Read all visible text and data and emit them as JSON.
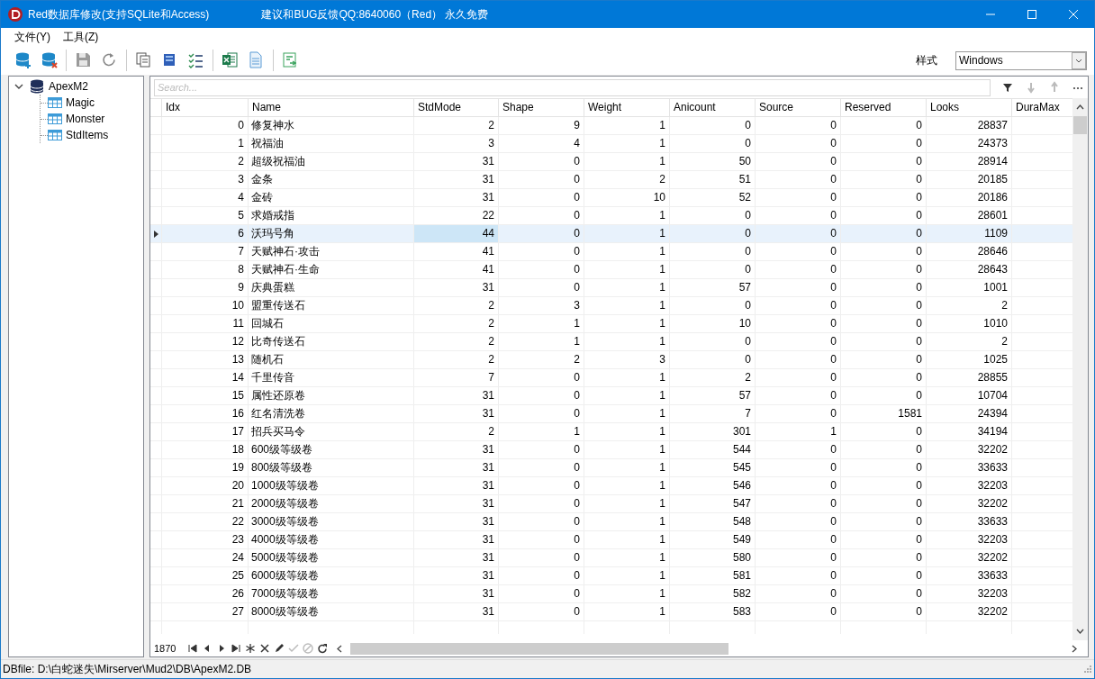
{
  "window": {
    "title": "Red数据库修改(支持SQLite和Access)",
    "subtitle": "建议和BUG反馈QQ:8640060（Red） 永久免费"
  },
  "menu": [
    "文件(Y)",
    "工具(Z)"
  ],
  "toolbar": {
    "style_label": "样式",
    "style_value": "Windows"
  },
  "tree": {
    "label": "ApexM2",
    "expanded": true,
    "children": [
      {
        "label": "Magic"
      },
      {
        "label": "Monster"
      },
      {
        "label": "StdItems"
      }
    ]
  },
  "grid": {
    "search_placeholder": "Search...",
    "columns": [
      "Idx",
      "Name",
      "StdMode",
      "Shape",
      "Weight",
      "Anicount",
      "Source",
      "Reserved",
      "Looks",
      "DuraMax"
    ],
    "rows": [
      {
        "selected": false,
        "cells": [
          "0",
          "修复神水",
          "2",
          "9",
          "1",
          "0",
          "0",
          "0",
          "28837"
        ]
      },
      {
        "selected": false,
        "cells": [
          "1",
          "祝福油",
          "3",
          "4",
          "1",
          "0",
          "0",
          "0",
          "24373"
        ]
      },
      {
        "selected": false,
        "cells": [
          "2",
          "超级祝福油",
          "31",
          "0",
          "1",
          "50",
          "0",
          "0",
          "28914"
        ]
      },
      {
        "selected": false,
        "cells": [
          "3",
          "金条",
          "31",
          "0",
          "2",
          "51",
          "0",
          "0",
          "20185"
        ]
      },
      {
        "selected": false,
        "cells": [
          "4",
          "金砖",
          "31",
          "0",
          "10",
          "52",
          "0",
          "0",
          "20186"
        ]
      },
      {
        "selected": false,
        "cells": [
          "5",
          "求婚戒指",
          "22",
          "0",
          "1",
          "0",
          "0",
          "0",
          "28601"
        ]
      },
      {
        "selected": true,
        "cells": [
          "6",
          "沃玛号角",
          "44",
          "0",
          "1",
          "0",
          "0",
          "0",
          "1109"
        ],
        "cell_focus": [
          false,
          false,
          true,
          false,
          false,
          false,
          false,
          false,
          false
        ]
      },
      {
        "selected": false,
        "cells": [
          "7",
          "天赋神石·攻击",
          "41",
          "0",
          "1",
          "0",
          "0",
          "0",
          "28646"
        ]
      },
      {
        "selected": false,
        "cells": [
          "8",
          "天赋神石·生命",
          "41",
          "0",
          "1",
          "0",
          "0",
          "0",
          "28643"
        ]
      },
      {
        "selected": false,
        "cells": [
          "9",
          "庆典蛋糕",
          "31",
          "0",
          "1",
          "57",
          "0",
          "0",
          "1001"
        ]
      },
      {
        "selected": false,
        "cells": [
          "10",
          "盟重传送石",
          "2",
          "3",
          "1",
          "0",
          "0",
          "0",
          "2"
        ]
      },
      {
        "selected": false,
        "cells": [
          "11",
          "回城石",
          "2",
          "1",
          "1",
          "10",
          "0",
          "0",
          "1010"
        ]
      },
      {
        "selected": false,
        "cells": [
          "12",
          "比奇传送石",
          "2",
          "1",
          "1",
          "0",
          "0",
          "0",
          "2"
        ]
      },
      {
        "selected": false,
        "cells": [
          "13",
          "随机石",
          "2",
          "2",
          "3",
          "0",
          "0",
          "0",
          "1025"
        ]
      },
      {
        "selected": false,
        "cells": [
          "14",
          "千里传音",
          "7",
          "0",
          "1",
          "2",
          "0",
          "0",
          "28855"
        ]
      },
      {
        "selected": false,
        "cells": [
          "15",
          "属性还原卷",
          "31",
          "0",
          "1",
          "57",
          "0",
          "0",
          "10704"
        ]
      },
      {
        "selected": false,
        "cells": [
          "16",
          "红名清洗卷",
          "31",
          "0",
          "1",
          "7",
          "0",
          "1581",
          "24394"
        ]
      },
      {
        "selected": false,
        "cells": [
          "17",
          "招兵买马令",
          "2",
          "1",
          "1",
          "301",
          "1",
          "0",
          "34194"
        ]
      },
      {
        "selected": false,
        "cells": [
          "18",
          "600级等级卷",
          "31",
          "0",
          "1",
          "544",
          "0",
          "0",
          "32202"
        ]
      },
      {
        "selected": false,
        "cells": [
          "19",
          "800级等级卷",
          "31",
          "0",
          "1",
          "545",
          "0",
          "0",
          "33633"
        ]
      },
      {
        "selected": false,
        "cells": [
          "20",
          "1000级等级卷",
          "31",
          "0",
          "1",
          "546",
          "0",
          "0",
          "32203"
        ]
      },
      {
        "selected": false,
        "cells": [
          "21",
          "2000级等级卷",
          "31",
          "0",
          "1",
          "547",
          "0",
          "0",
          "32202"
        ]
      },
      {
        "selected": false,
        "cells": [
          "22",
          "3000级等级卷",
          "31",
          "0",
          "1",
          "548",
          "0",
          "0",
          "33633"
        ]
      },
      {
        "selected": false,
        "cells": [
          "23",
          "4000级等级卷",
          "31",
          "0",
          "1",
          "549",
          "0",
          "0",
          "32203"
        ]
      },
      {
        "selected": false,
        "cells": [
          "24",
          "5000级等级卷",
          "31",
          "0",
          "1",
          "580",
          "0",
          "0",
          "32202"
        ]
      },
      {
        "selected": false,
        "cells": [
          "25",
          "6000级等级卷",
          "31",
          "0",
          "1",
          "581",
          "0",
          "0",
          "33633"
        ]
      },
      {
        "selected": false,
        "cells": [
          "26",
          "7000级等级卷",
          "31",
          "0",
          "1",
          "582",
          "0",
          "0",
          "32203"
        ]
      },
      {
        "selected": false,
        "cells": [
          "27",
          "8000级等级卷",
          "31",
          "0",
          "1",
          "583",
          "0",
          "0",
          "32202"
        ]
      }
    ],
    "record_count": "1870"
  },
  "status_bar": "DBfile: D:\\白蛇迷失\\Mirserver\\Mud2\\DB\\ApexM2.DB"
}
